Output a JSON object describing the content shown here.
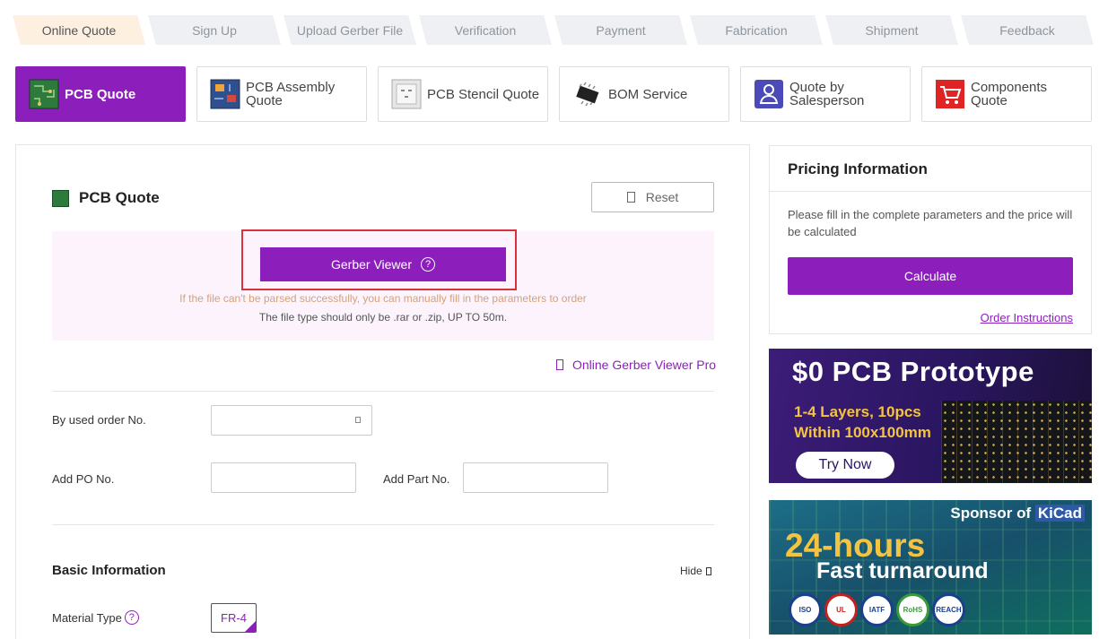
{
  "steps": [
    "Online Quote",
    "Sign Up",
    "Upload Gerber File",
    "Verification",
    "Payment",
    "Fabrication",
    "Shipment",
    "Feedback"
  ],
  "services": [
    {
      "label": "PCB Quote",
      "icon": "pcb-board-icon"
    },
    {
      "label": "PCB Assembly Quote",
      "icon": "pcb-assembly-icon"
    },
    {
      "label": "PCB Stencil Quote",
      "icon": "stencil-icon"
    },
    {
      "label": "BOM Service",
      "icon": "chip-icon"
    },
    {
      "label": "Quote by Salesperson",
      "icon": "salesperson-icon"
    },
    {
      "label": "Components Quote",
      "icon": "shopping-cart-icon"
    }
  ],
  "main": {
    "title": "PCB Quote",
    "reset_label": "Reset",
    "gerber_viewer_label": "Gerber Viewer",
    "help_glyph": "?",
    "hint_parse": "If the file can't be parsed successfully, you can manually fill in the parameters to order",
    "hint_type": "The file type should only be .rar or .zip, UP TO 50m.",
    "gerber_pro_label": "Online Gerber Viewer Pro",
    "used_order_label": "By used order No.",
    "used_order_value": "",
    "po_label": "Add PO No.",
    "po_value": "",
    "part_label": "Add Part No.",
    "part_value": "",
    "basic_info_title": "Basic Information",
    "hide_label": "Hide",
    "material_label": "Material Type",
    "material_value": "FR-4"
  },
  "pricing": {
    "title": "Pricing Information",
    "description": "Please fill in the complete parameters and the price will be calculated",
    "calculate_label": "Calculate",
    "order_instructions": "Order Instructions"
  },
  "banner_prototype": {
    "headline": "$0 PCB Prototype",
    "line1": "1-4 Layers, 10pcs",
    "line2": "Within 100x100mm",
    "cta": "Try Now"
  },
  "banner_kicad": {
    "sponsor": "Sponsor of",
    "brand": "KiCad",
    "hours": "24-hours",
    "turnaround": "Fast turnaround",
    "certs": [
      "ISO",
      "UL",
      "IATF",
      "RoHS",
      "REACH"
    ]
  },
  "colors": {
    "accent": "#8c1fbc",
    "highlight": "#d9323d",
    "banner_purple": "#2a1660"
  }
}
